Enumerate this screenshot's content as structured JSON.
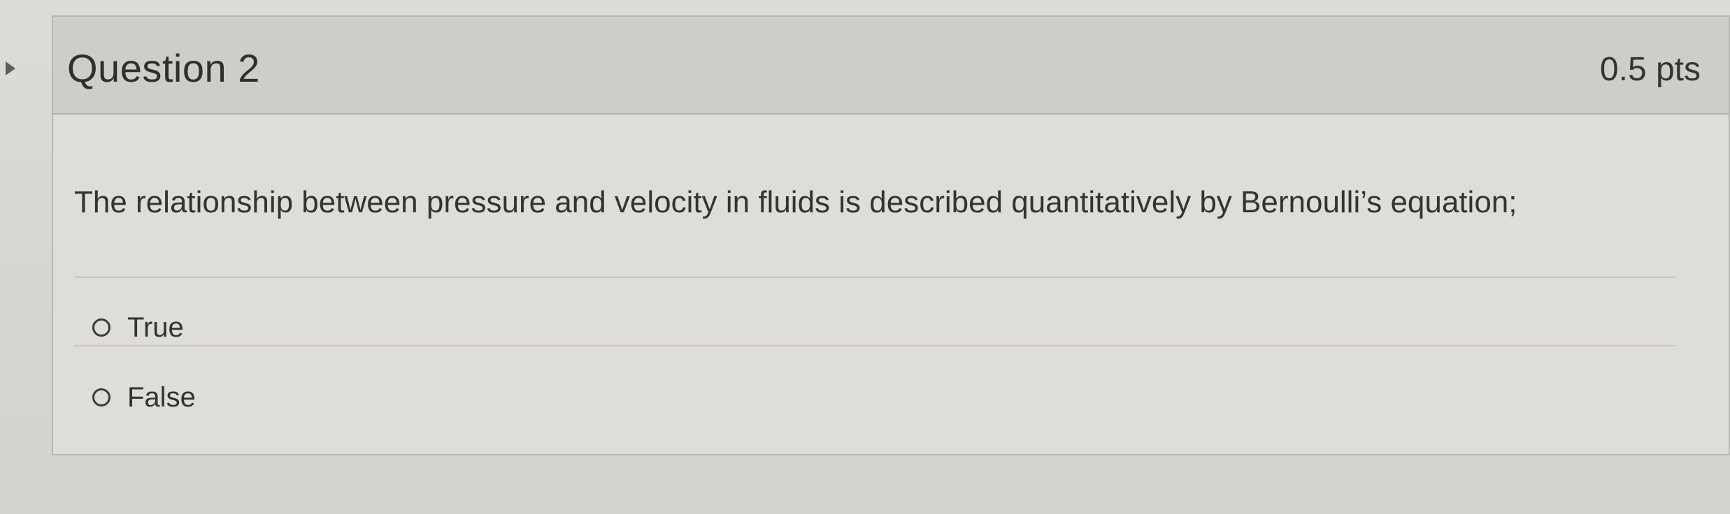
{
  "question": {
    "title": "Question 2",
    "points": "0.5 pts",
    "text": "The relationship between pressure and velocity in fluids is described quantitatively by Bernoulli’s equation;"
  },
  "answers": [
    {
      "label": "True",
      "selected": false
    },
    {
      "label": "False",
      "selected": false
    }
  ],
  "icons": {
    "left_indicator": "chevron-right-icon",
    "radio": "radio-button-icon"
  },
  "colors": {
    "text": "#333333",
    "header_bg": "#cfcdc8",
    "card_bg": "#dfddd8",
    "border": "#b7b6b1"
  }
}
